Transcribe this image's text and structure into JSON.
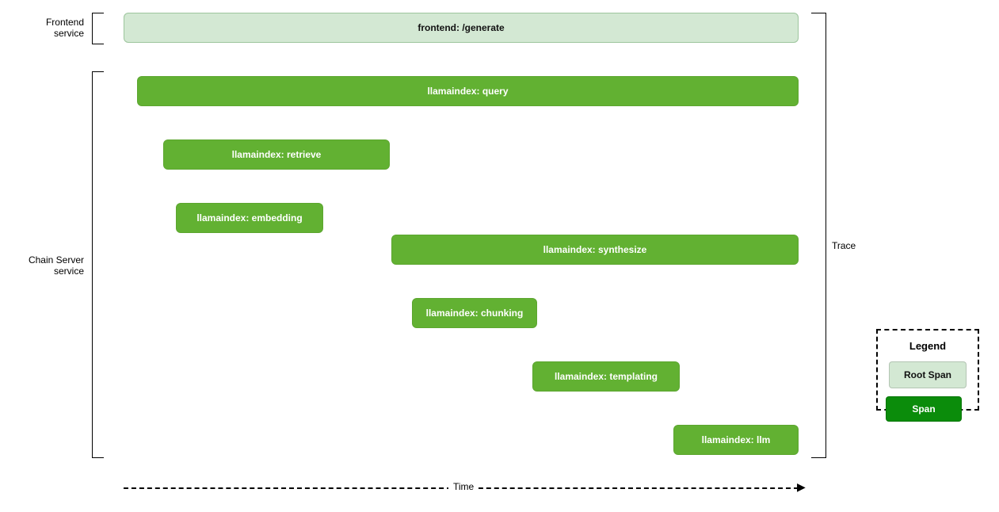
{
  "rows": {
    "frontend_l1": "Frontend",
    "frontend_l2": "service",
    "chain_l1": "Chain Server",
    "chain_l2": "service"
  },
  "spans": {
    "root": "frontend: /generate",
    "query": "llamaindex: query",
    "retrieve": "llamaindex: retrieve",
    "embedding": "llamaindex: embedding",
    "synthesize": "llamaindex: synthesize",
    "chunking": "llamaindex: chunking",
    "templating": "llamaindex: templating",
    "llm": "llamaindex: llm"
  },
  "annotations": {
    "trace_label": "Trace",
    "time_label": "Time"
  },
  "legend": {
    "title": "Legend",
    "root": "Root Span",
    "span": "Span"
  },
  "chart_data": {
    "type": "gantt",
    "title": "Distributed trace spans",
    "time_axis": {
      "start": 0,
      "end": 100,
      "unit": "relative"
    },
    "services": [
      {
        "name": "Frontend service",
        "spans": [
          "frontend: /generate"
        ]
      },
      {
        "name": "Chain Server service",
        "spans": [
          "llamaindex: query",
          "llamaindex: retrieve",
          "llamaindex: embedding",
          "llamaindex: synthesize",
          "llamaindex: chunking",
          "llamaindex: templating",
          "llamaindex: llm"
        ]
      }
    ],
    "spans": [
      {
        "name": "frontend: /generate",
        "service": "Frontend service",
        "start": 0,
        "end": 100,
        "root": true,
        "depth": 0
      },
      {
        "name": "llamaindex: query",
        "service": "Chain Server service",
        "start": 2,
        "end": 100,
        "root": false,
        "depth": 1
      },
      {
        "name": "llamaindex: retrieve",
        "service": "Chain Server service",
        "start": 6,
        "end": 40,
        "root": false,
        "depth": 2
      },
      {
        "name": "llamaindex: embedding",
        "service": "Chain Server service",
        "start": 8,
        "end": 30,
        "root": false,
        "depth": 3
      },
      {
        "name": "llamaindex: synthesize",
        "service": "Chain Server service",
        "start": 40,
        "end": 100,
        "root": false,
        "depth": 2
      },
      {
        "name": "llamaindex: chunking",
        "service": "Chain Server service",
        "start": 43,
        "end": 62,
        "root": false,
        "depth": 3
      },
      {
        "name": "llamaindex: templating",
        "service": "Chain Server service",
        "start": 61,
        "end": 83,
        "root": false,
        "depth": 3
      },
      {
        "name": "llamaindex: llm",
        "service": "Chain Server service",
        "start": 82,
        "end": 100,
        "root": false,
        "depth": 3
      }
    ]
  }
}
